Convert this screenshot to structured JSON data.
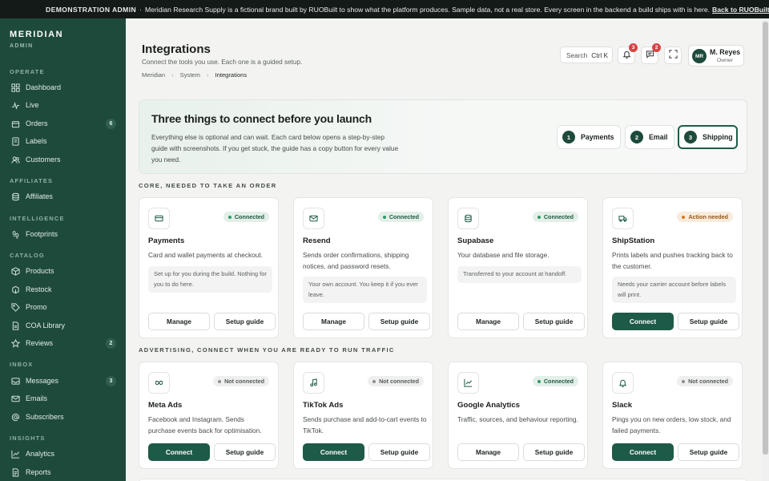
{
  "banner": {
    "label": "DEMONSTRATION ADMIN",
    "separator": "·",
    "text": "Meridian Research Supply is a fictional brand built by RUOBuilt to show what the platform produces. Sample data, not a real store. Every screen in the backend a build ships with is here.",
    "link": "Back to RUOBuilt →"
  },
  "sidebar": {
    "brand": "MERIDIAN",
    "brand_sub": "ADMIN",
    "sections": {
      "operate": "OPERATE",
      "affiliates": "AFFILIATES",
      "intelligence": "INTELLIGENCE",
      "catalog": "CATALOG",
      "inbox": "INBOX",
      "insights": "INSIGHTS"
    },
    "items": {
      "dashboard": {
        "label": "Dashboard",
        "icon": "grid-icon"
      },
      "live": {
        "label": "Live",
        "icon": "pulse-icon"
      },
      "orders": {
        "label": "Orders",
        "icon": "box-icon",
        "count": "6"
      },
      "labels": {
        "label": "Labels",
        "icon": "label-icon"
      },
      "customers": {
        "label": "Customers",
        "icon": "users-icon"
      },
      "affiliates": {
        "label": "Affiliates",
        "icon": "database-icon"
      },
      "footprints": {
        "label": "Footprints",
        "icon": "footprints-icon"
      },
      "products": {
        "label": "Products",
        "icon": "products-icon"
      },
      "restock": {
        "label": "Restock",
        "icon": "restock-icon"
      },
      "promo": {
        "label": "Promo",
        "icon": "tag-icon"
      },
      "coa": {
        "label": "COA Library",
        "icon": "document-icon"
      },
      "reviews": {
        "label": "Reviews",
        "icon": "star-icon",
        "count": "2"
      },
      "messages": {
        "label": "Messages",
        "icon": "inbox-icon",
        "count": "3"
      },
      "emails": {
        "label": "Emails",
        "icon": "mail-icon"
      },
      "subscribers": {
        "label": "Subscribers",
        "icon": "at-icon"
      },
      "analytics": {
        "label": "Analytics",
        "icon": "chart-line-icon"
      },
      "reports": {
        "label": "Reports",
        "icon": "report-icon"
      }
    }
  },
  "header": {
    "title": "Integrations",
    "subtitle": "Connect the tools you use. Each one is a guided setup.",
    "breadcrumb": [
      "Meridian",
      "System",
      "Integrations"
    ],
    "breadcrumb_sep": "›",
    "search_label": "Search",
    "search_shortcut": "Ctrl K",
    "notifications_count": "3",
    "messages_count": "2",
    "user": {
      "initials": "MR",
      "name": "M. Reyes",
      "role": "Owner"
    }
  },
  "hero": {
    "title": "Three things to connect before you launch",
    "text": "Everything else is optional and can wait. Each card below opens a step-by-step guide with screenshots. If you get stuck, the guide has a copy button for every value you need.",
    "steps": [
      {
        "num": "1",
        "label": "Payments"
      },
      {
        "num": "2",
        "label": "Email"
      },
      {
        "num": "3",
        "label": "Shipping"
      }
    ]
  },
  "sections": {
    "core": "CORE, NEEDED TO TAKE AN ORDER",
    "ads": "ADVERTISING, CONNECT WHEN YOU ARE READY TO RUN TRAFFIC"
  },
  "cards": {
    "payments": {
      "name": "Payments",
      "status": "Connected",
      "desc": "Card and wallet payments at checkout.",
      "note": "Set up for you during the build. Nothing for you to do here.",
      "action": "Manage",
      "guide": "Setup guide",
      "icon": "card-icon"
    },
    "resend": {
      "name": "Resend",
      "status": "Connected",
      "desc": "Sends order confirmations, shipping notices, and password resets.",
      "note": "Your own account. You keep it if you ever leave.",
      "action": "Manage",
      "guide": "Setup guide",
      "icon": "mail-icon"
    },
    "supabase": {
      "name": "Supabase",
      "status": "Connected",
      "desc": "Your database and file storage.",
      "note": "Transferred to your account at handoff.",
      "action": "Manage",
      "guide": "Setup guide",
      "icon": "database-icon"
    },
    "shipstation": {
      "name": "ShipStation",
      "status": "Action needed",
      "desc": "Prints labels and pushes tracking back to the customer.",
      "note": "Needs your carrier account before labels will print.",
      "action": "Connect",
      "guide": "Setup guide",
      "icon": "truck-icon"
    },
    "meta": {
      "name": "Meta Ads",
      "status": "Not connected",
      "desc": "Facebook and Instagram. Sends purchase events back for optimisation.",
      "action": "Connect",
      "guide": "Setup guide",
      "icon": "infinity-icon"
    },
    "tiktok": {
      "name": "TikTok Ads",
      "status": "Not connected",
      "desc": "Sends purchase and add-to-cart events to TikTok.",
      "action": "Connect",
      "guide": "Setup guide",
      "icon": "music-note-icon"
    },
    "ga": {
      "name": "Google Analytics",
      "status": "Connected",
      "desc": "Traffic, sources, and behaviour reporting.",
      "action": "Manage",
      "guide": "Setup guide",
      "icon": "chart-line-icon"
    },
    "slack": {
      "name": "Slack",
      "status": "Not connected",
      "desc": "Pings you on new orders, low stock, and failed payments.",
      "action": "Connect",
      "guide": "Setup guide",
      "icon": "bell-icon"
    }
  }
}
